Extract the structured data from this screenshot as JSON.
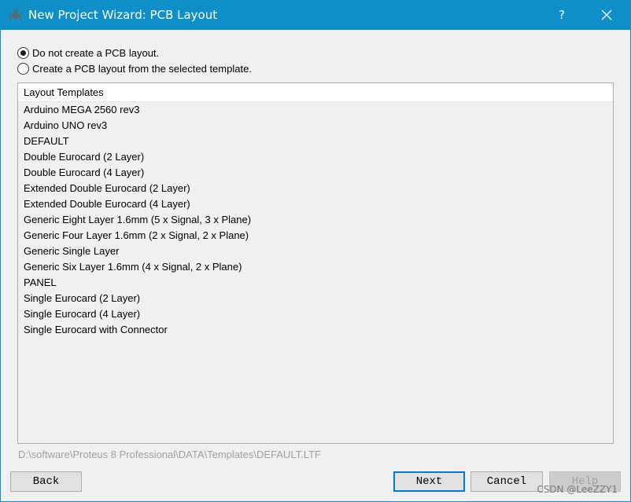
{
  "titlebar": {
    "title": "New Project Wizard: PCB Layout",
    "help_label": "?",
    "icons": {
      "app": "proteus-app-icon",
      "close": "close-icon"
    }
  },
  "options": {
    "no_layout": "Do not create a PCB layout.",
    "from_template": "Create a PCB layout from the selected template.",
    "selected": "no_layout"
  },
  "list": {
    "header": "Layout Templates",
    "items": [
      "Arduino MEGA 2560 rev3",
      "Arduino UNO rev3",
      "DEFAULT",
      "Double Eurocard (2 Layer)",
      "Double Eurocard (4 Layer)",
      "Extended Double Eurocard (2 Layer)",
      "Extended Double Eurocard (4 Layer)",
      "Generic Eight Layer 1.6mm (5 x Signal, 3 x Plane)",
      "Generic Four Layer 1.6mm (2 x Signal, 2 x Plane)",
      "Generic Single Layer",
      "Generic Six Layer 1.6mm (4 x Signal, 2 x Plane)",
      "PANEL",
      "Single Eurocard (2 Layer)",
      "Single Eurocard (4 Layer)",
      "Single Eurocard with Connector"
    ]
  },
  "template_path": "D:\\software\\Proteus 8 Professional\\DATA\\Templates\\DEFAULT.LTF",
  "buttons": {
    "back": "Back",
    "next": "Next",
    "cancel": "Cancel",
    "help": "Help"
  },
  "watermark": "CSDN @LeeZZY1",
  "colors": {
    "titlebar": "#0f8fc7",
    "client": "#f0f0f0",
    "accent": "#0078d7"
  }
}
